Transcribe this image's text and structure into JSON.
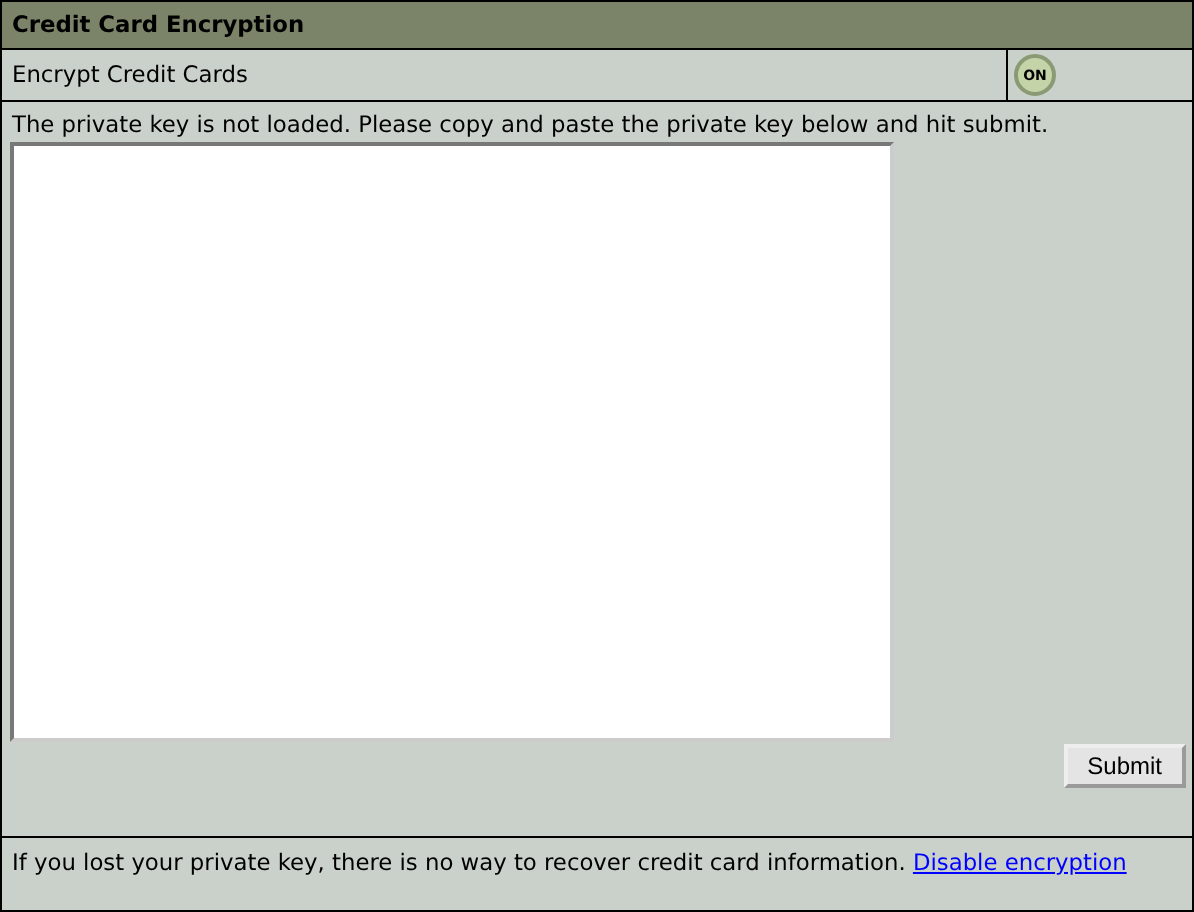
{
  "panel": {
    "title": "Credit Card Encryption"
  },
  "setting": {
    "label": "Encrypt Credit Cards",
    "toggle": {
      "label": "ON",
      "on": true
    }
  },
  "key_form": {
    "message": "The private key is not loaded. Please copy and paste the private key below and hit submit.",
    "submit": "Submit"
  },
  "footer": {
    "text": "If you lost your private key, there is no way to recover credit card information.",
    "link": "Disable encryption"
  }
}
